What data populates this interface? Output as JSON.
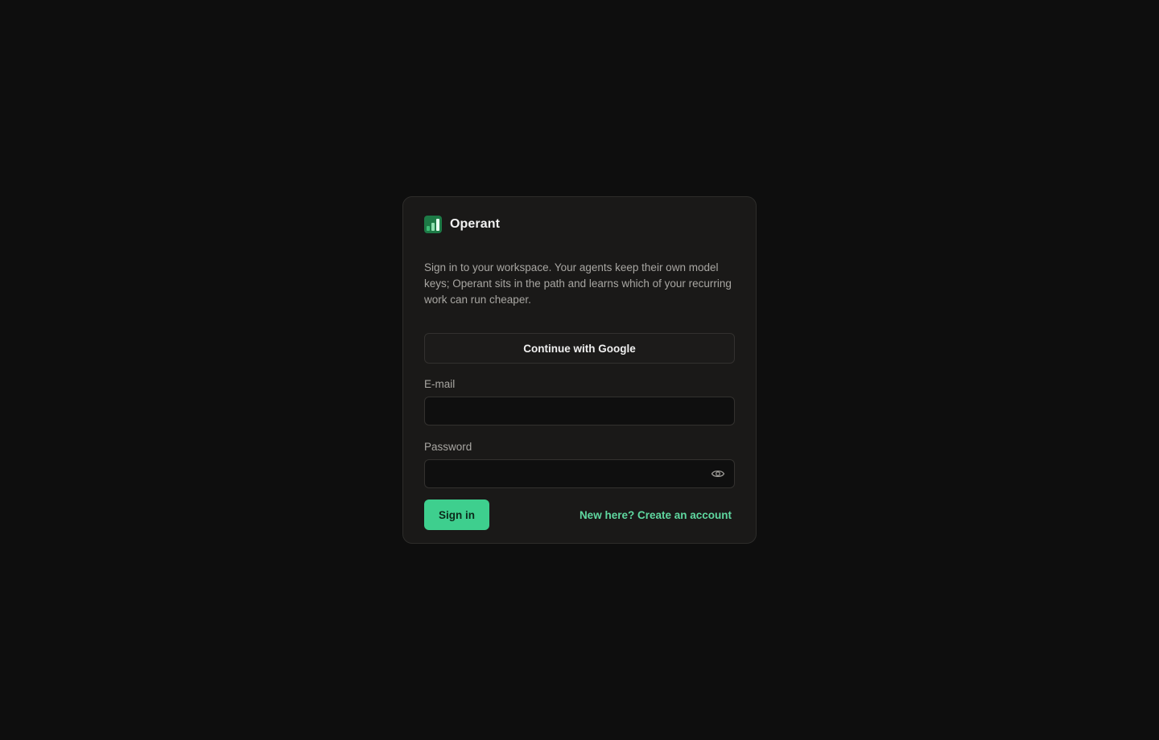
{
  "brand": {
    "name": "Operant",
    "accent": "#3ecf8e"
  },
  "intro": "Sign in to your workspace. Your agents keep their own model keys; Operant sits in the path and learns which of your recurring work can run cheaper.",
  "google_button": {
    "label": "Continue with Google"
  },
  "email": {
    "label": "E-mail",
    "value": "",
    "placeholder": ""
  },
  "password": {
    "label": "Password",
    "value": "",
    "placeholder": "",
    "toggle_icon": "eye-icon"
  },
  "actions": {
    "signin_label": "Sign in",
    "create_account_label": "New here? Create an account"
  }
}
